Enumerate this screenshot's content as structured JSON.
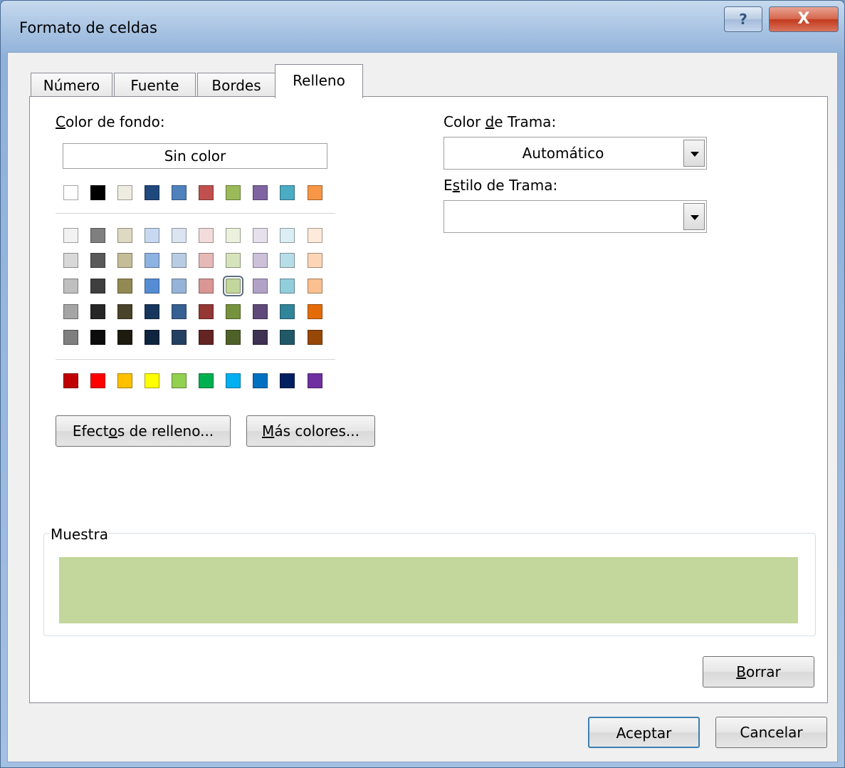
{
  "window": {
    "title": "Formato de celdas",
    "help_glyph": "?",
    "close_glyph": "X"
  },
  "tabs": [
    {
      "label": "Número",
      "active": false
    },
    {
      "label": "Fuente",
      "active": false
    },
    {
      "label": "Bordes",
      "active": false
    },
    {
      "label": "Relleno",
      "active": true
    }
  ],
  "fill": {
    "background_color_label": "Color de fondo:",
    "no_color_label": "Sin color",
    "theme_colors_row": [
      "#ffffff",
      "#000000",
      "#eeece1",
      "#1f497d",
      "#4f81bd",
      "#c0504d",
      "#9bbb59",
      "#8064a2",
      "#4bacc6",
      "#f79646"
    ],
    "tint_rows": [
      [
        "#f2f2f2",
        "#7f7f7f",
        "#ddd9c3",
        "#c6d9f0",
        "#dbe5f1",
        "#f2dcdb",
        "#ebf1dd",
        "#e5e0ec",
        "#dbeef3",
        "#fdeada"
      ],
      [
        "#d8d8d8",
        "#595959",
        "#c4bd97",
        "#8db3e2",
        "#b8cce4",
        "#e5b9b7",
        "#d7e3bc",
        "#ccc1d9",
        "#b7dde8",
        "#fbd5b5"
      ],
      [
        "#bfbfbf",
        "#3f3f3f",
        "#938953",
        "#548dd4",
        "#95b3d7",
        "#d99694",
        "#c3d69b",
        "#b2a2c7",
        "#92cddc",
        "#fac08f"
      ],
      [
        "#a5a5a5",
        "#262626",
        "#494429",
        "#17365d",
        "#366092",
        "#953734",
        "#76923c",
        "#5f497a",
        "#31859b",
        "#e36c09"
      ],
      [
        "#7f7f7f",
        "#0c0c0c",
        "#1d1b10",
        "#0f243e",
        "#244061",
        "#632423",
        "#4f6128",
        "#3f3151",
        "#205867",
        "#974806"
      ]
    ],
    "standard_colors": [
      "#c00000",
      "#ff0000",
      "#ffc000",
      "#ffff00",
      "#92d050",
      "#00b050",
      "#00b0f0",
      "#0070c0",
      "#002060",
      "#7030a0"
    ],
    "selected_color": "#c3d69b",
    "fill_effects_label": "Efectos de relleno...",
    "more_colors_label": "Más colores...",
    "pattern_color_label": "Color de Trama:",
    "pattern_color_value": "Automático",
    "pattern_style_label": "Estilo de Trama:",
    "pattern_style_value": "",
    "sample_label": "Muestra",
    "clear_label": "Borrar"
  },
  "footer": {
    "ok_label": "Aceptar",
    "cancel_label": "Cancelar"
  }
}
